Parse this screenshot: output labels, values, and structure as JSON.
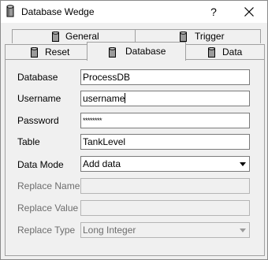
{
  "window": {
    "title": "Database Wedge",
    "help_label": "?"
  },
  "tabs": {
    "general": "General",
    "trigger": "Trigger",
    "reset": "Reset",
    "database": "Database",
    "data": "Data"
  },
  "form": {
    "database": {
      "label": "Database",
      "value": "ProcessDB"
    },
    "username": {
      "label": "Username",
      "value": "username"
    },
    "password": {
      "label": "Password",
      "value": "********"
    },
    "table": {
      "label": "Table",
      "value": "TankLevel"
    },
    "data_mode": {
      "label": "Data Mode",
      "value": "Add data"
    },
    "replace_name": {
      "label": "Replace Name",
      "value": ""
    },
    "replace_value": {
      "label": "Replace Value",
      "value": ""
    },
    "replace_type": {
      "label": "Replace Type",
      "value": "Long Integer"
    }
  },
  "icons": {
    "app": "database-icon",
    "tab": "database-icon",
    "close": "close-icon",
    "dropdown": "chevron-down-icon"
  }
}
